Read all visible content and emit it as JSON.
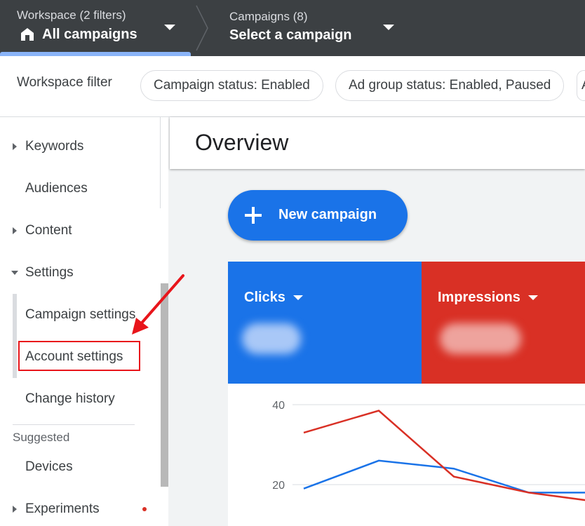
{
  "topbar": {
    "workspace_sub": "Workspace (2 filters)",
    "workspace_main": "All campaigns",
    "campaigns_sub": "Campaigns (8)",
    "campaigns_main": "Select a campaign"
  },
  "filterbar": {
    "label": "Workspace filter",
    "chips": [
      "Campaign status: Enabled",
      "Ad group status: Enabled, Paused",
      "A"
    ]
  },
  "sidebar": {
    "keywords": "Keywords",
    "audiences": "Audiences",
    "content": "Content",
    "settings": "Settings",
    "campaign_settings": "Campaign settings",
    "account_settings": "Account settings",
    "change_history": "Change history",
    "suggested_heading": "Suggested",
    "devices": "Devices",
    "experiments": "Experiments"
  },
  "main": {
    "title": "Overview",
    "new_campaign": "New campaign"
  },
  "metrics": {
    "clicks_label": "Clicks",
    "impressions_label": "Impressions",
    "clicks_color": "#1a73e8",
    "impressions_color": "#d93025"
  },
  "chart_data": {
    "type": "line",
    "y_ticks": [
      "40",
      "20"
    ],
    "ylim": [
      0,
      40
    ],
    "series": [
      {
        "name": "Clicks",
        "color": "#1a73e8",
        "values": [
          19,
          26,
          24,
          18,
          18
        ]
      },
      {
        "name": "Impressions",
        "color": "#d93025",
        "values": [
          33,
          38.5,
          22,
          18,
          15.5
        ]
      }
    ]
  },
  "annotation": {
    "color": "#e8151b"
  }
}
